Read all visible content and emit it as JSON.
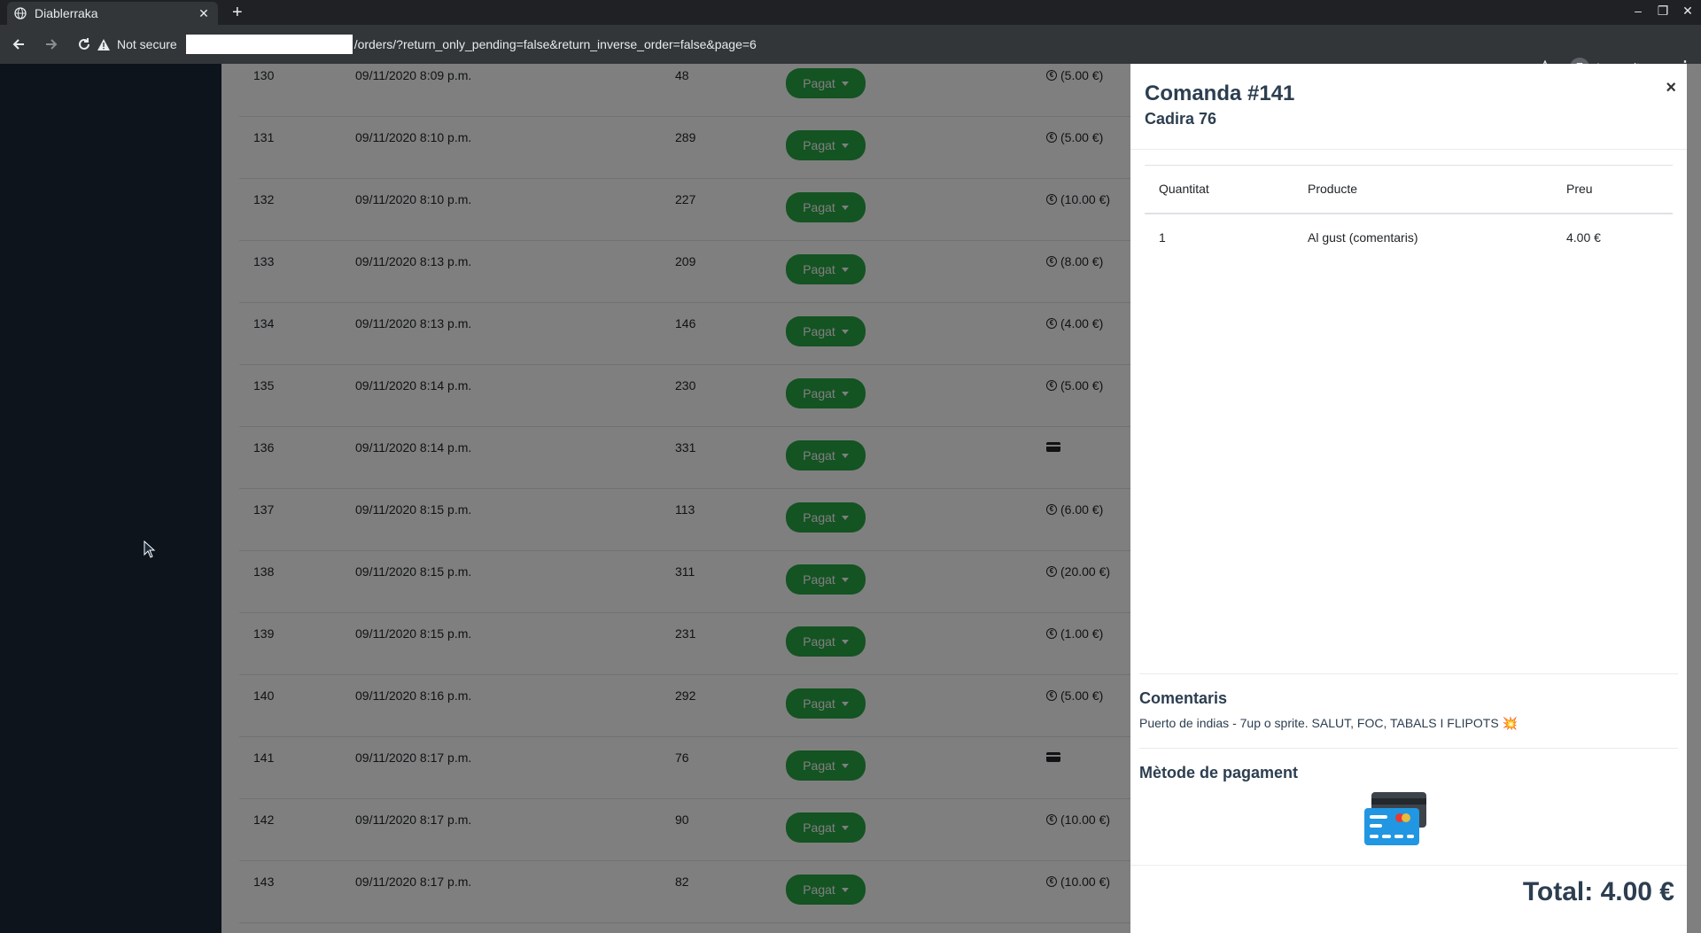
{
  "browser": {
    "tab_title": "Diablerraka",
    "security_label": "Not secure",
    "url_path": "/orders/?return_only_pending=false&return_inverse_order=false&page=6",
    "profile_label": "Incognito"
  },
  "orders": {
    "status_label": "Pagat",
    "rows": [
      {
        "id": "130",
        "date": "09/11/2020 8:09 p.m.",
        "seat": "48",
        "payment": "cash",
        "amount": "(5.00 €)"
      },
      {
        "id": "131",
        "date": "09/11/2020 8:10 p.m.",
        "seat": "289",
        "payment": "cash",
        "amount": "(5.00 €)"
      },
      {
        "id": "132",
        "date": "09/11/2020 8:10 p.m.",
        "seat": "227",
        "payment": "cash",
        "amount": "(10.00 €)"
      },
      {
        "id": "133",
        "date": "09/11/2020 8:13 p.m.",
        "seat": "209",
        "payment": "cash",
        "amount": "(8.00 €)"
      },
      {
        "id": "134",
        "date": "09/11/2020 8:13 p.m.",
        "seat": "146",
        "payment": "cash",
        "amount": "(4.00 €)"
      },
      {
        "id": "135",
        "date": "09/11/2020 8:14 p.m.",
        "seat": "230",
        "payment": "cash",
        "amount": "(5.00 €)"
      },
      {
        "id": "136",
        "date": "09/11/2020 8:14 p.m.",
        "seat": "331",
        "payment": "card",
        "amount": ""
      },
      {
        "id": "137",
        "date": "09/11/2020 8:15 p.m.",
        "seat": "113",
        "payment": "cash",
        "amount": "(6.00 €)"
      },
      {
        "id": "138",
        "date": "09/11/2020 8:15 p.m.",
        "seat": "311",
        "payment": "cash",
        "amount": "(20.00 €)"
      },
      {
        "id": "139",
        "date": "09/11/2020 8:15 p.m.",
        "seat": "231",
        "payment": "cash",
        "amount": "(1.00 €)"
      },
      {
        "id": "140",
        "date": "09/11/2020 8:16 p.m.",
        "seat": "292",
        "payment": "cash",
        "amount": "(5.00 €)"
      },
      {
        "id": "141",
        "date": "09/11/2020 8:17 p.m.",
        "seat": "76",
        "payment": "card",
        "amount": ""
      },
      {
        "id": "142",
        "date": "09/11/2020 8:17 p.m.",
        "seat": "90",
        "payment": "cash",
        "amount": "(10.00 €)"
      },
      {
        "id": "143",
        "date": "09/11/2020 8:17 p.m.",
        "seat": "82",
        "payment": "cash",
        "amount": "(10.00 €)"
      }
    ]
  },
  "panel": {
    "title": "Comanda #141",
    "subtitle": "Cadira 76",
    "close_label": "×",
    "columns": {
      "qty": "Quantitat",
      "product": "Producte",
      "price": "Preu"
    },
    "items": [
      {
        "qty": "1",
        "product": "Al gust (comentaris)",
        "price": "4.00 €"
      }
    ],
    "comments_title": "Comentaris",
    "comments_text": "Puerto de indias - 7up o sprite. SALUT, FOC, TABALS I FLIPOTS 💥",
    "payment_title": "Mètode de pagament",
    "payment_icon": "credit-card-icon",
    "total": "Total: 4.00 €"
  },
  "colors": {
    "accent_green": "#28a745",
    "heading": "#2c3e50",
    "sidebar": "#1b2838"
  }
}
